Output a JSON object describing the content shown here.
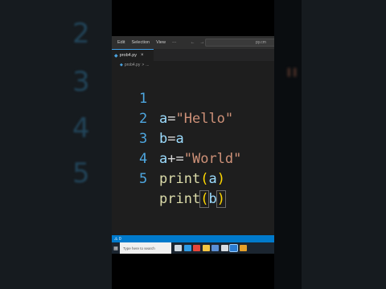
{
  "background": {
    "line_numbers": [
      "2",
      "3",
      "4",
      "5"
    ],
    "quote": "\""
  },
  "menubar": {
    "items": [
      "Edit",
      "Selection",
      "View",
      "···"
    ],
    "back": "←",
    "forward": "→",
    "title": "py.cm"
  },
  "tab": {
    "label": "prob4.py",
    "close": "×",
    "icon": "python-file-icon"
  },
  "breadcrumb": {
    "file": "prob4.py",
    "separator": ">",
    "rest": "..."
  },
  "code": {
    "lines": [
      {
        "num": "1",
        "parts": [
          "a",
          "=",
          "\"Hello\""
        ]
      },
      {
        "num": "2",
        "parts": [
          "b",
          "=",
          "a"
        ]
      },
      {
        "num": "3",
        "parts": [
          "a",
          "+=",
          "\"World\""
        ]
      },
      {
        "num": "4",
        "parts": [
          "print",
          "(",
          "a",
          ")"
        ]
      },
      {
        "num": "5",
        "parts": [
          "print",
          "(",
          "b",
          ")"
        ]
      }
    ]
  },
  "statusbar": {
    "text": "⚠ 0"
  },
  "taskbar": {
    "search_placeholder": "Type here to search",
    "icons": [
      "task-view-icon",
      "edge-icon",
      "chrome-icon",
      "file-explorer-icon",
      "store-icon",
      "mail-icon",
      "vscode-icon",
      "app-icon"
    ],
    "colors": [
      "#cfd8e0",
      "#2f9ce6",
      "#e8463a",
      "#f4c542",
      "#5b8fd6",
      "#d8dde3",
      "#2b7bd1",
      "#e5a02a"
    ]
  },
  "colors": {
    "accent": "#007acc",
    "line_number": "#4ea7e0",
    "string": "#ce9178",
    "function": "#dcdcaa",
    "paren": "#ffd700",
    "variable": "#9cdcfe"
  }
}
